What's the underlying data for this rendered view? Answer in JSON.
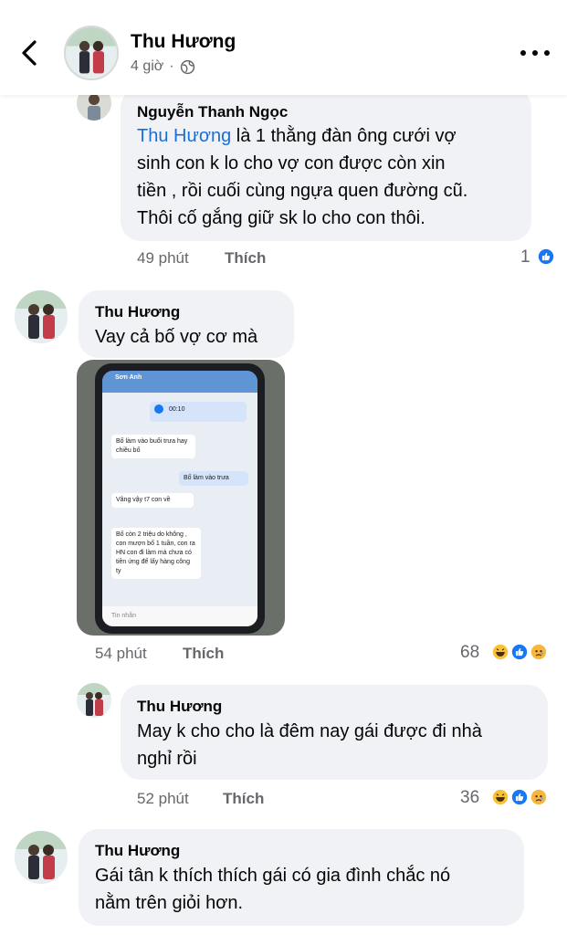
{
  "header": {
    "name": "Thu Hương",
    "time": "4 giờ",
    "separator": "·"
  },
  "comments": [
    {
      "author": "Nguyễn Thanh Ngọc",
      "mention": "Thu Hương",
      "text_line1": " là 1 thằng đàn ông cưới vợ",
      "text_line2": "sinh con k lo cho vợ con được còn xin",
      "text_line3": "tiền , rồi cuối cùng ngựa quen đường cũ.",
      "text_line4": "Thôi cố gắng giữ sk lo cho con thôi.",
      "time": "49 phút",
      "like_label": "Thích",
      "reaction_count": "1",
      "reactions": [
        "like-icon"
      ]
    },
    {
      "author": "Thu Hương",
      "text": "Vay cả bố vợ cơ mà",
      "time": "54 phút",
      "like_label": "Thích",
      "reaction_count": "68",
      "reactions": [
        "haha-icon",
        "like-icon",
        "sad-icon"
      ],
      "photo": {
        "chat_title": "Sơn Anh",
        "voice_duration": "00:10",
        "messages": [
          {
            "from": "them",
            "text": "Bố làm vào buổi trưa hay chiều bố"
          },
          {
            "from": "me",
            "text": "Bố làm vào trưa"
          },
          {
            "from": "them",
            "text": "Vâng vậy t7 con về"
          },
          {
            "from": "them",
            "text": "Bố còn 2 triệu do không , con mượn bố 1 tuần, con ra HN con đi làm mà chưa có tiền ứng để lấy hàng công ty"
          }
        ],
        "input_placeholder": "Tin nhắn"
      }
    },
    {
      "author": "Thu Hương",
      "text_line1": "May k cho cho là đêm nay gái được đi nhà",
      "text_line2": "nghỉ rồi",
      "time": "52 phút",
      "like_label": "Thích",
      "reaction_count": "36",
      "reactions": [
        "haha-icon",
        "like-icon",
        "sad-icon"
      ]
    },
    {
      "author": "Thu Hương",
      "text_line1": "Gái tân k thích thích gái có gia đình chắc nó",
      "text_line2": "nằm trên giỏi hơn."
    }
  ],
  "colors": {
    "bubble": "#f0f2f5",
    "meta": "#65676b",
    "mention": "#1a6ed8",
    "like_blue": "#1877f2",
    "haha_yellow": "#f7c233",
    "sad_yellow": "#f5b73e"
  }
}
